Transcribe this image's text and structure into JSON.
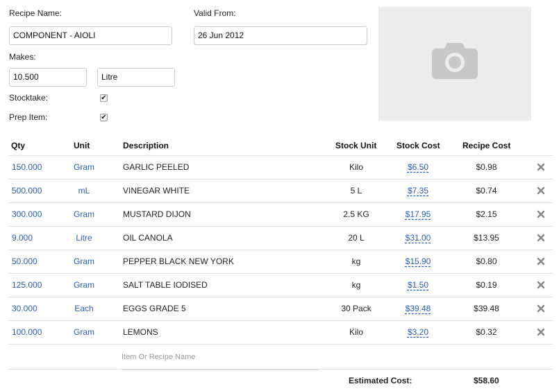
{
  "form": {
    "recipe_name_label": "Recipe Name:",
    "recipe_name_value": "COMPONENT - AIOLI",
    "valid_from_label": "Valid From:",
    "valid_from_value": "26 Jun 2012",
    "makes_label": "Makes:",
    "makes_qty": "10.500",
    "makes_unit": "Litre",
    "stocktake_label": "Stocktake:",
    "stocktake_checked": true,
    "prep_item_label": "Prep Item:",
    "prep_item_checked": true,
    "photo_icon": "camera-icon"
  },
  "table": {
    "headers": {
      "qty": "Qty",
      "unit": "Unit",
      "description": "Description",
      "stock_unit": "Stock Unit",
      "stock_cost": "Stock Cost",
      "recipe_cost": "Recipe Cost"
    },
    "rows": [
      {
        "qty": "150.000",
        "unit": "Gram",
        "description": "GARLIC PEELED",
        "stock_unit": "Kilo",
        "stock_cost": "$6.50",
        "recipe_cost": "$0.98"
      },
      {
        "qty": "500.000",
        "unit": "mL",
        "description": "VINEGAR WHITE",
        "stock_unit": "5 L",
        "stock_cost": "$7.35",
        "recipe_cost": "$0.74"
      },
      {
        "qty": "300.000",
        "unit": "Gram",
        "description": "MUSTARD DIJON",
        "stock_unit": "2.5 KG",
        "stock_cost": "$17.95",
        "recipe_cost": "$2.15"
      },
      {
        "qty": "9.000",
        "unit": "Litre",
        "description": "OIL CANOLA",
        "stock_unit": "20 L",
        "stock_cost": "$31.00",
        "recipe_cost": "$13.95"
      },
      {
        "qty": "50.000",
        "unit": "Gram",
        "description": "PEPPER BLACK NEW YORK",
        "stock_unit": "kg",
        "stock_cost": "$15.90",
        "recipe_cost": "$0.80"
      },
      {
        "qty": "125.000",
        "unit": "Gram",
        "description": "SALT TABLE IODISED",
        "stock_unit": "kg",
        "stock_cost": "$1.50",
        "recipe_cost": "$0.19"
      },
      {
        "qty": "30.000",
        "unit": "Each",
        "description": "EGGS GRADE 5",
        "stock_unit": "30 Pack",
        "stock_cost": "$39.48",
        "recipe_cost": "$39.48"
      },
      {
        "qty": "100.000",
        "unit": "Gram",
        "description": "LEMONS",
        "stock_unit": "Kilo",
        "stock_cost": "$3.20",
        "recipe_cost": "$0.32"
      }
    ],
    "delete_icon": "close-icon",
    "add_item_placeholder": "Item Or Recipe Name"
  },
  "footer": {
    "estimated_cost_label": "Estimated Cost:",
    "estimated_cost_value": "$58.60"
  },
  "colors": {
    "link_blue": "#2a5db0",
    "photo_bg": "#ececec",
    "camera_icon": "#c8c8c8",
    "delete_icon": "#8a8a8a"
  }
}
